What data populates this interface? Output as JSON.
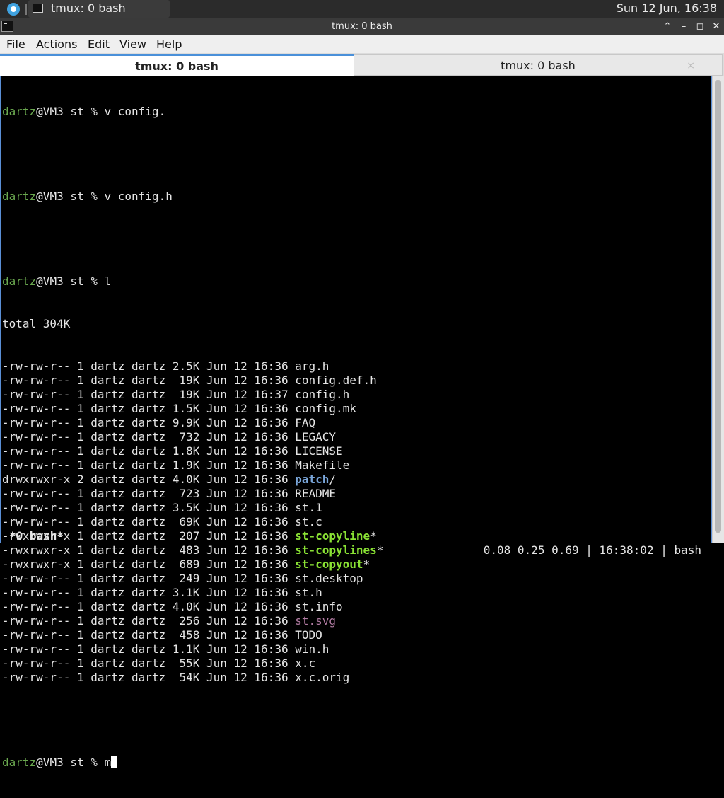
{
  "panel": {
    "task_label": "tmux: 0 bash",
    "clock": "Sun 12 Jun, 16:38"
  },
  "window": {
    "title": "tmux: 0 bash",
    "controls": {
      "shade": "⌃",
      "minimize": "–",
      "maximize": "◻",
      "close": "✕"
    }
  },
  "menu": [
    "File",
    "Actions",
    "Edit",
    "View",
    "Help"
  ],
  "tabs": [
    {
      "label": "tmux: 0 bash",
      "active": true
    },
    {
      "label": "tmux: 0 bash",
      "active": false,
      "close": "×"
    }
  ],
  "terminal": {
    "user": "dartz",
    "prompt_host": "@VM3 st % ",
    "commands": [
      "v config.",
      "v config.h",
      "l"
    ],
    "total": "total 304K",
    "listing": [
      {
        "prefix": "-rw-rw-r-- 1 dartz dartz 2.5K Jun 12 16:36 ",
        "name": "arg.h",
        "type": "file",
        "suffix": ""
      },
      {
        "prefix": "-rw-rw-r-- 1 dartz dartz  19K Jun 12 16:36 ",
        "name": "config.def.h",
        "type": "file",
        "suffix": ""
      },
      {
        "prefix": "-rw-rw-r-- 1 dartz dartz  19K Jun 12 16:37 ",
        "name": "config.h",
        "type": "file",
        "suffix": ""
      },
      {
        "prefix": "-rw-rw-r-- 1 dartz dartz 1.5K Jun 12 16:36 ",
        "name": "config.mk",
        "type": "file",
        "suffix": ""
      },
      {
        "prefix": "-rw-rw-r-- 1 dartz dartz 9.9K Jun 12 16:36 ",
        "name": "FAQ",
        "type": "file",
        "suffix": ""
      },
      {
        "prefix": "-rw-rw-r-- 1 dartz dartz  732 Jun 12 16:36 ",
        "name": "LEGACY",
        "type": "file",
        "suffix": ""
      },
      {
        "prefix": "-rw-rw-r-- 1 dartz dartz 1.8K Jun 12 16:36 ",
        "name": "LICENSE",
        "type": "file",
        "suffix": ""
      },
      {
        "prefix": "-rw-rw-r-- 1 dartz dartz 1.9K Jun 12 16:36 ",
        "name": "Makefile",
        "type": "file",
        "suffix": ""
      },
      {
        "prefix": "drwxrwxr-x 2 dartz dartz 4.0K Jun 12 16:36 ",
        "name": "patch",
        "type": "dir",
        "suffix": "/"
      },
      {
        "prefix": "-rw-rw-r-- 1 dartz dartz  723 Jun 12 16:36 ",
        "name": "README",
        "type": "file",
        "suffix": ""
      },
      {
        "prefix": "-rw-rw-r-- 1 dartz dartz 3.5K Jun 12 16:36 ",
        "name": "st.1",
        "type": "file",
        "suffix": ""
      },
      {
        "prefix": "-rw-rw-r-- 1 dartz dartz  69K Jun 12 16:36 ",
        "name": "st.c",
        "type": "file",
        "suffix": ""
      },
      {
        "prefix": "-rwxrwxr-x 1 dartz dartz  207 Jun 12 16:36 ",
        "name": "st-copyline",
        "type": "exe",
        "suffix": "*"
      },
      {
        "prefix": "-rwxrwxr-x 1 dartz dartz  483 Jun 12 16:36 ",
        "name": "st-copylines",
        "type": "exe",
        "suffix": "*"
      },
      {
        "prefix": "-rwxrwxr-x 1 dartz dartz  689 Jun 12 16:36 ",
        "name": "st-copyout",
        "type": "exe",
        "suffix": "*"
      },
      {
        "prefix": "-rw-rw-r-- 1 dartz dartz  249 Jun 12 16:36 ",
        "name": "st.desktop",
        "type": "file",
        "suffix": ""
      },
      {
        "prefix": "-rw-rw-r-- 1 dartz dartz 3.1K Jun 12 16:36 ",
        "name": "st.h",
        "type": "file",
        "suffix": ""
      },
      {
        "prefix": "-rw-rw-r-- 1 dartz dartz 4.0K Jun 12 16:36 ",
        "name": "st.info",
        "type": "file",
        "suffix": ""
      },
      {
        "prefix": "-rw-rw-r-- 1 dartz dartz  256 Jun 12 16:36 ",
        "name": "st.svg",
        "type": "img",
        "suffix": ""
      },
      {
        "prefix": "-rw-rw-r-- 1 dartz dartz  458 Jun 12 16:36 ",
        "name": "TODO",
        "type": "file",
        "suffix": ""
      },
      {
        "prefix": "-rw-rw-r-- 1 dartz dartz 1.1K Jun 12 16:36 ",
        "name": "win.h",
        "type": "file",
        "suffix": ""
      },
      {
        "prefix": "-rw-rw-r-- 1 dartz dartz  55K Jun 12 16:36 ",
        "name": "x.c",
        "type": "file",
        "suffix": ""
      },
      {
        "prefix": "-rw-rw-r-- 1 dartz dartz  54K Jun 12 16:36 ",
        "name": "x.c.orig",
        "type": "file",
        "suffix": ""
      }
    ],
    "current_input": "m"
  },
  "tmux_status": {
    "window": "*0 bash*",
    "right": "0.08 0.25 0.69 | 16:38:02 | bash"
  },
  "colors": {
    "user": "#6aa84f",
    "dir": "#7aa6da",
    "exe": "#8ae234",
    "img": "#b07aa1",
    "accent": "#4a90d9"
  }
}
